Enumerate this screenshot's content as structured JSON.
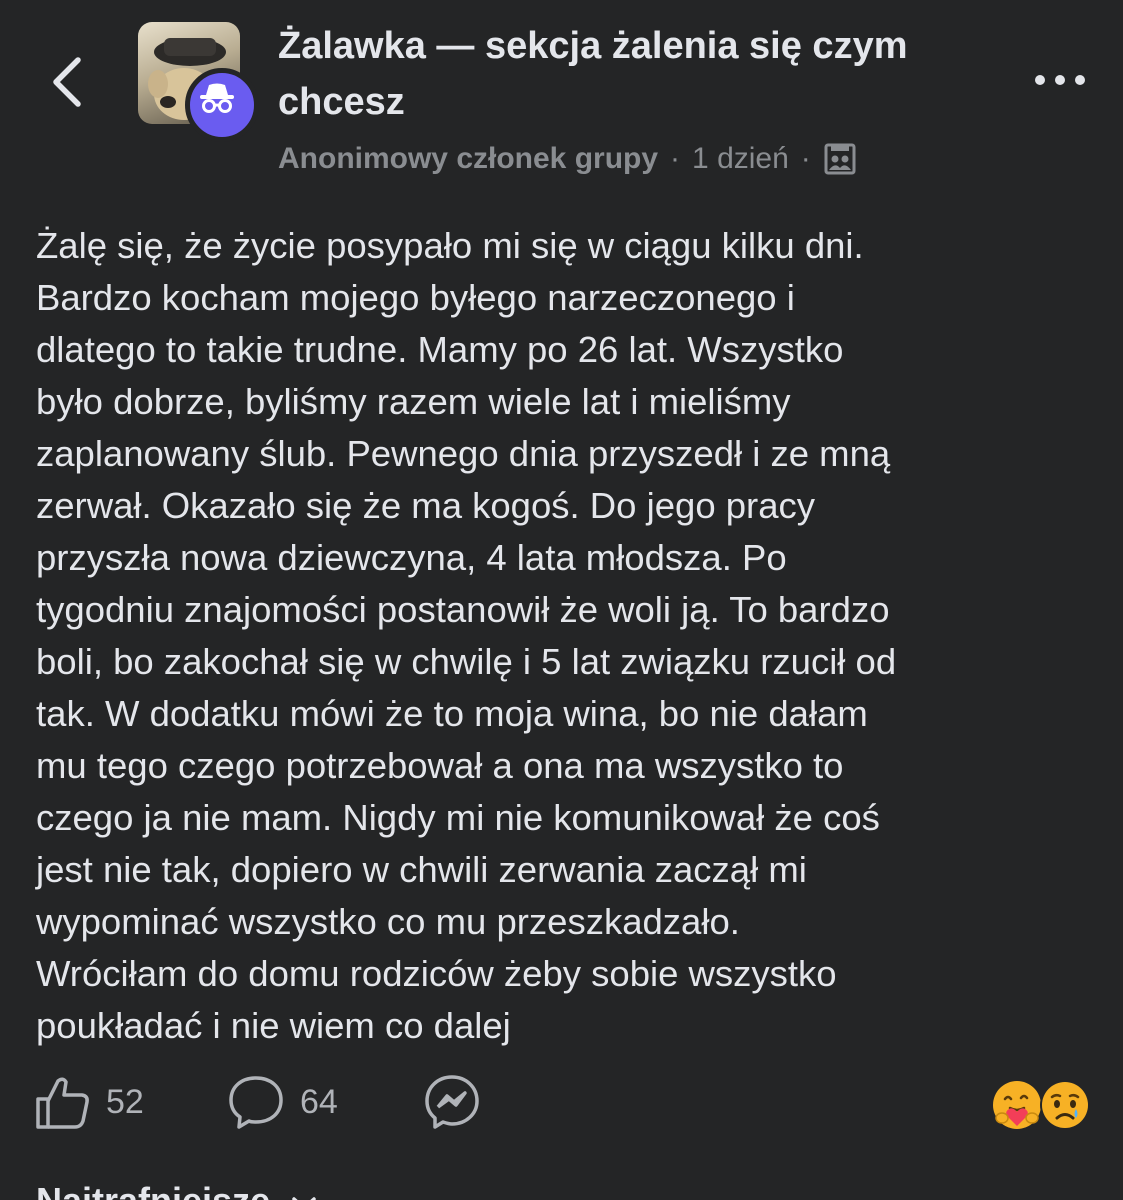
{
  "header": {
    "group_title": "Żalawka — sekcja żalenia się czym chcesz",
    "author": "Anonimowy członek grupy",
    "separator": "·",
    "time": "1 dzień",
    "audience_icon": "group-audience-icon",
    "back_icon": "chevron-left-icon",
    "more_icon": "more-horizontal-icon",
    "anonymous_badge_icon": "incognito-icon"
  },
  "post": {
    "text": "Żalę się, że życie posypało mi się w ciągu kilku dni.\nBardzo kocham mojego byłego narzeczonego i\ndlatego to takie trudne. Mamy po 26 lat. Wszystko\nbyło dobrze, byliśmy razem wiele lat i mieliśmy\nzaplanowany ślub. Pewnego dnia przyszedł i ze mną\nzerwał. Okazało się że ma kogoś. Do jego pracy\nprzyszła nowa dziewczyna, 4 lata młodsza. Po\ntygodniu znajomości postanowił że woli ją. To bardzo\nboli, bo zakochał się w chwilę i 5 lat związku rzucił od\ntak. W dodatku mówi że to moja wina, bo nie dałam\nmu tego czego potrzebował a ona ma wszystko to\nczego ja nie mam. Nigdy mi nie komunikował że coś\njest nie tak, dopiero w chwili zerwania zaczął mi\nwypominać wszystko co mu przeszkadzało.\nWróciłam do domu rodziców żeby sobie wszystko\npoukładać i nie wiem co dalej"
  },
  "actions": {
    "like_count": "52",
    "comment_count": "64",
    "like_icon": "thumbs-up-icon",
    "comment_icon": "comment-bubble-icon",
    "share_icon": "messenger-icon",
    "reactions": [
      "care-reaction-icon",
      "sad-reaction-icon"
    ]
  },
  "footer": {
    "next_label": "Najtrafniejsze"
  },
  "colors": {
    "background": "#242526",
    "text_primary": "#e4e6eb",
    "text_secondary": "#8a8d91",
    "anonymous_badge": "#6a5cf0",
    "care_reaction": "#f7b125",
    "heart": "#f33e58"
  }
}
